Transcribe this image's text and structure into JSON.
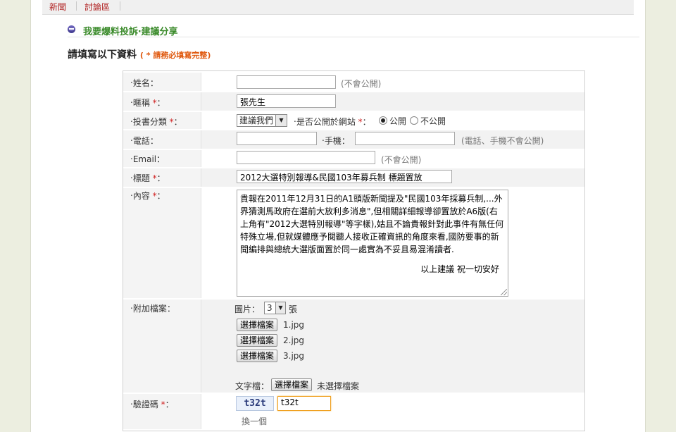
{
  "nav": {
    "items": [
      "新聞",
      "討論區"
    ]
  },
  "section_title": "我要爆料投訴‧建議分享",
  "form_heading": "請填寫以下資料",
  "form_heading_note": "( * 請務必填寫完整)",
  "required_mark": "*",
  "fields": {
    "name": {
      "label": "‧姓名：",
      "value": "",
      "hint": "(不會公開)"
    },
    "nickname": {
      "label": "‧暱稱",
      "value": "張先生"
    },
    "category": {
      "label": "‧投書分類",
      "selected": "建議我們",
      "public_label": "‧是否公開於網站",
      "options": [
        "公開",
        "不公開"
      ],
      "selected_option": "公開"
    },
    "phone": {
      "label": "‧電話：",
      "value": "",
      "mobile_label": "‧手機：",
      "mobile_value": "",
      "hint": "(電話、手機不會公開)"
    },
    "email": {
      "label": "‧Email：",
      "value": "",
      "hint": "(不會公開)"
    },
    "title": {
      "label": "‧標題",
      "value": "2012大選特別報導&民國103年募兵制 標題置放"
    },
    "content": {
      "label": "‧內容",
      "body": "貴報在2011年12月31日的A1頭版新聞提及\"民國103年採募兵制,...外界猜測馬政府在選前大放利多消息\",但相關詳細報導卻置放於A6版(右上角有\"2012大選特別報導\"等字樣),姑且不論貴報針對此事件有無任何特殊立場,但就媒體應予閱聽人接收正確資訊的角度來看,國防要事的新聞編排與總統大選版面置於同一處實為不妥且易混淆讀者.",
      "sign": "以上建議  祝一切安好"
    },
    "attachments": {
      "label": "‧附加檔案：",
      "image_label": "圖片：",
      "image_count": "3",
      "unit": "張",
      "choose_label": "選擇檔案",
      "files": [
        "1.jpg",
        "2.jpg",
        "3.jpg"
      ],
      "text_file_label": "文字檔：",
      "text_file_status": "未選擇檔案"
    },
    "captcha": {
      "label": "‧驗證碼",
      "image_text": "t32t",
      "value": "t32t",
      "refresh": "換一個"
    }
  }
}
